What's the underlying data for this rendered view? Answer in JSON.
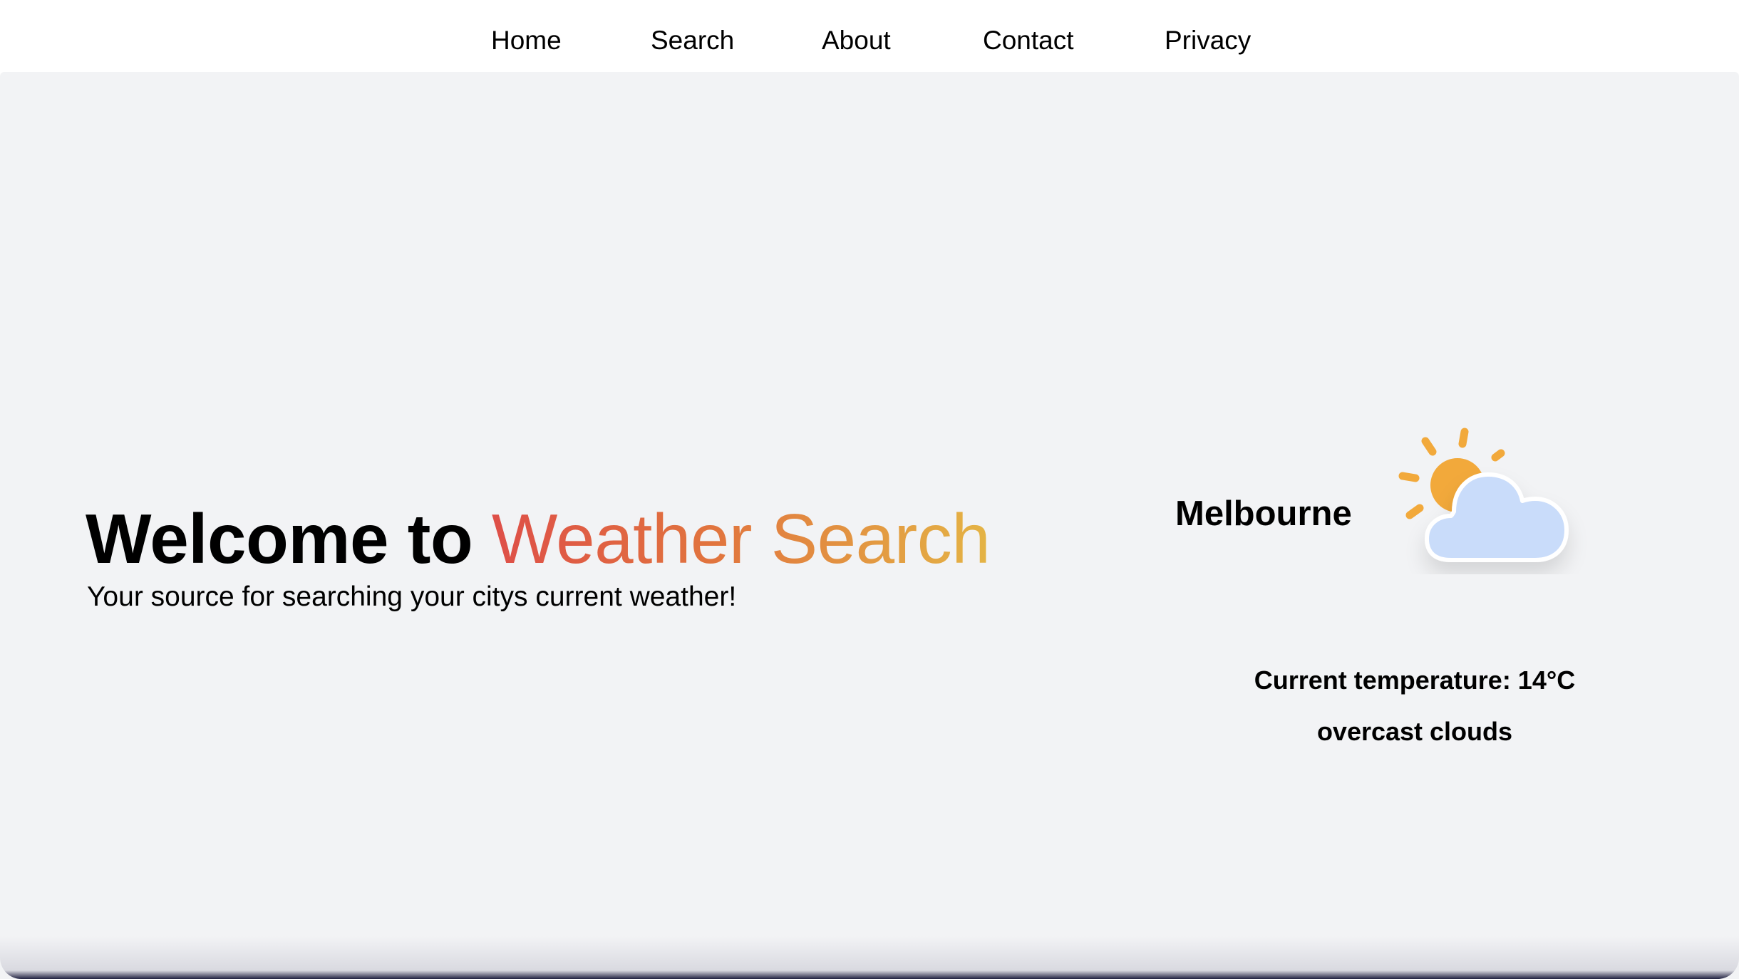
{
  "nav": {
    "items": [
      {
        "label": "Home"
      },
      {
        "label": "Search"
      },
      {
        "label": "About"
      },
      {
        "label": "Contact"
      },
      {
        "label": "Privacy"
      }
    ]
  },
  "hero": {
    "title_prefix": "Welcome to ",
    "title_highlight": "Weather Search",
    "subtitle": "Your source for searching your citys current weather!",
    "gradient_colors": [
      "#de4f48",
      "#e1753e",
      "#e4b445"
    ]
  },
  "weather": {
    "city": "Melbourne",
    "icon": "partly-cloudy-icon",
    "temperature_text": "Current temperature: 14°C",
    "description": "overcast clouds",
    "sun_color": "#f2a93b",
    "cloud_color": "#c9dcfa"
  },
  "colors": {
    "background": "#f2f3f5",
    "nav_background": "#ffffff",
    "text": "#000000"
  }
}
